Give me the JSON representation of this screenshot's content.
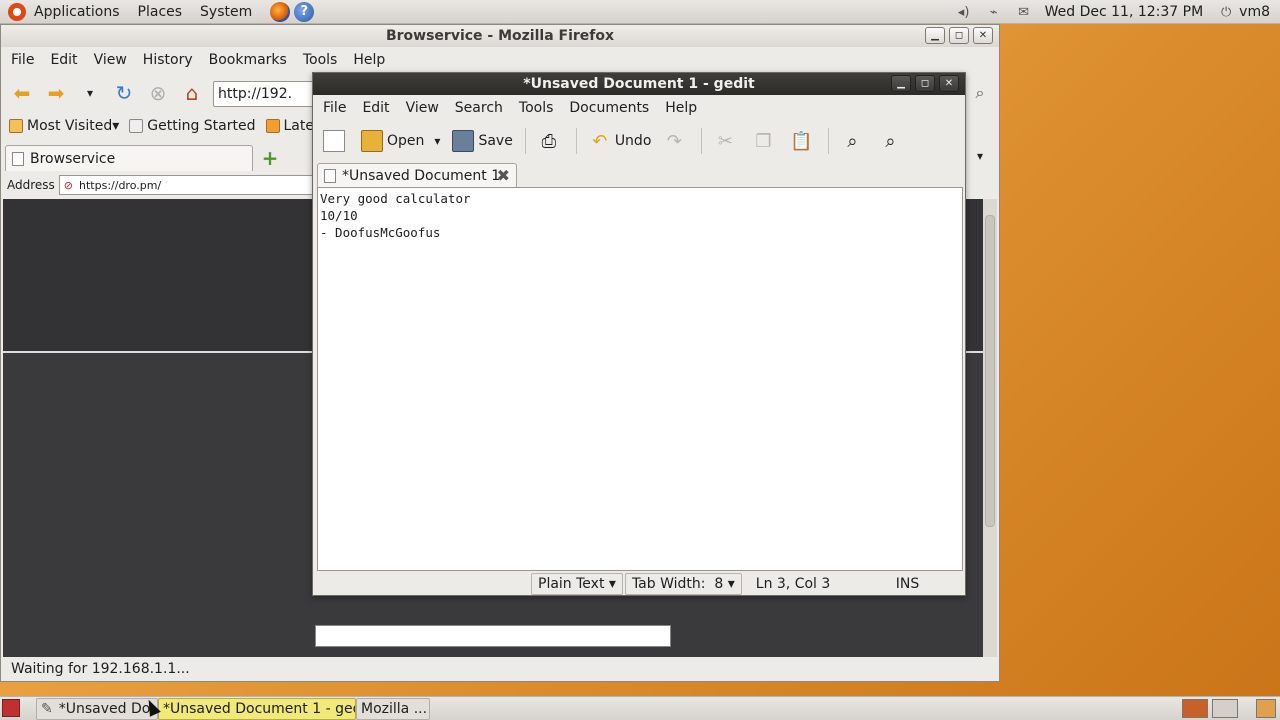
{
  "top_panel": {
    "applications": "Applications",
    "places": "Places",
    "system": "System",
    "clock": "Wed Dec 11, 12:37 PM",
    "user": "vm8"
  },
  "firefox": {
    "title": "Browservice - Mozilla Firefox",
    "menu": [
      "File",
      "Edit",
      "View",
      "History",
      "Bookmarks",
      "Tools",
      "Help"
    ],
    "url": "http://192.",
    "bookmarks": {
      "most_visited": "Most Visited",
      "getting_started": "Getting Started",
      "latest": "Late"
    },
    "tab_title": "Browservice",
    "address_label": "Address",
    "address_value": "https://dro.pm/",
    "status": "Waiting for 192.168.1.1..."
  },
  "gedit": {
    "title": "*Unsaved Document 1 - gedit",
    "menu": [
      "File",
      "Edit",
      "View",
      "Search",
      "Tools",
      "Documents",
      "Help"
    ],
    "toolbar": {
      "open": "Open",
      "save": "Save",
      "undo": "Undo"
    },
    "tab_title": "*Unsaved Document 1",
    "content": "Very good calculator\n10/10\n- DoofusMcGoofus",
    "status": {
      "language": "Plain Text",
      "tab_width": "Tab Width:  8",
      "position": "Ln 3, Col 3",
      "mode": "INS"
    }
  },
  "taskbar": {
    "items": [
      "*Unsaved Do",
      "*Unsaved Document 1 - gedit",
      "Mozilla ..."
    ]
  }
}
